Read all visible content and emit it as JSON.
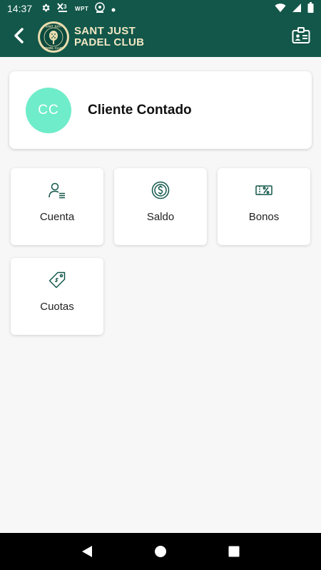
{
  "status_bar": {
    "time": "14:37",
    "notifications": [
      "gear-icon",
      "x3-padel-icon",
      "wpt-icon",
      "club-mini-icon",
      "dot-icon"
    ],
    "wpt_label": "WPT"
  },
  "header": {
    "brand_line1": "SANT JUST",
    "brand_line2": "PADEL CLUB",
    "logo_text_top": "SANT JUST",
    "logo_text_bottom": "PADEL CLUB",
    "bar_color": "#12574a",
    "brand_color": "#f2e7c4"
  },
  "profile": {
    "initials": "CC",
    "name": "Cliente Contado",
    "avatar_color": "#6fecc9"
  },
  "menu": {
    "cuenta": "Cuenta",
    "saldo": "Saldo",
    "bonos": "Bonos",
    "cuotas": "Cuotas"
  }
}
